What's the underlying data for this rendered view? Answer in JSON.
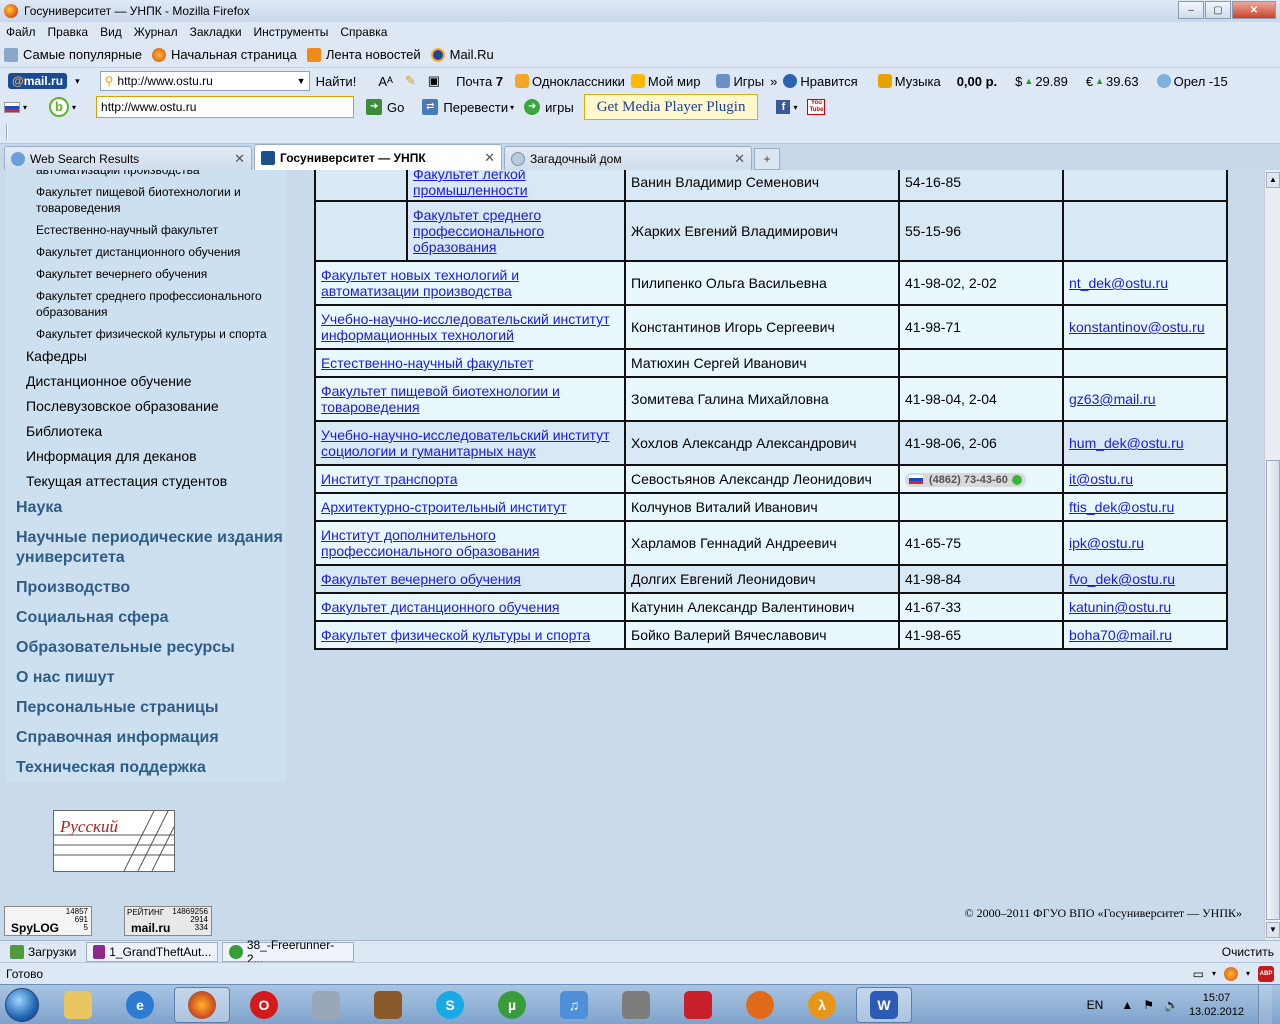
{
  "window": {
    "title": "Госуниверситет — УНПК - Mozilla Firefox",
    "min": "‒",
    "max": "▢",
    "close": "✕"
  },
  "menu": [
    "Файл",
    "Правка",
    "Вид",
    "Журнал",
    "Закладки",
    "Инструменты",
    "Справка"
  ],
  "bookmarks": [
    "Самые популярные",
    "Начальная страница",
    "Лента новостей",
    "Mail.Ru"
  ],
  "mailru_toolbar": {
    "logo_prefix": "@",
    "logo_text": "mail.ru",
    "url": "http://www.ostu.ru",
    "find": "Найти!",
    "mail": "Почта",
    "mail_count": "7",
    "odnoklassniki": "Одноклассники",
    "moimir": "Мой мир",
    "games": "Игры",
    "more": "»",
    "like": "Нравится",
    "music": "Музыка",
    "balance": "0,00 р.",
    "usd_sym": "$",
    "usd": "29.89",
    "eur_sym": "€",
    "eur": "39.63",
    "weather": "Орел -15"
  },
  "bing_toolbar": {
    "input": "http://www.ostu.ru",
    "go": "Go",
    "translate": "Перевести",
    "games": "игры",
    "media_plugin": "Get Media Player Plugin",
    "youtube": "You Tube"
  },
  "tabs": [
    {
      "label": "Web Search Results",
      "close": "✕"
    },
    {
      "label": "Госуниверситет — УНПК",
      "close": "✕"
    },
    {
      "label": "Загадочный дом",
      "close": "✕"
    }
  ],
  "newtab": "+",
  "left_nav": {
    "sub_items": [
      "автоматизации производства",
      "Факультет пищевой биотехнологии и товароведения",
      "Естественно-научный факультет",
      "Факультет дистанционного обучения",
      "Факультет вечернего обучения",
      "Факультет среднего профессионального образования",
      "Факультет физической культуры и спорта"
    ],
    "sections": [
      "Кафедры",
      "Дистанционное обучение",
      "Послевузовское образование",
      "Библиотека",
      "Информация для деканов",
      "Текущая аттестация студентов"
    ],
    "top_items": [
      "Наука",
      "Научные периодические издания университета",
      "Производство",
      "Социальная сфера",
      "Образовательные ресурсы",
      "О нас пишут",
      "Персональные страницы",
      "Справочная информация",
      "Техническая поддержка"
    ]
  },
  "table": {
    "sub_rows": [
      {
        "name": "Факультет легкой промышленности",
        "head": "Ванин Владимир Семенович",
        "phone": "54-16-85",
        "email": ""
      },
      {
        "name": "Факультет среднего профессионального образования",
        "head": "Жарких Евгений Владимирович",
        "phone": "55-15-96",
        "email": ""
      }
    ],
    "rows": [
      {
        "name": "Факультет новых технологий и автоматизации производства",
        "head": "Пилипенко Ольга Васильевна",
        "phone": "41-98-02, 2-02",
        "email": "nt_dek@ostu.ru"
      },
      {
        "name": "Учебно-научно-исследовательский институт информационных технологий",
        "head": "Константинов Игорь Сергеевич",
        "phone": "41-98-71",
        "email": "konstantinov@ostu.ru"
      },
      {
        "name": "Естественно-научный факультет",
        "head": "Матюхин Сергей Иванович",
        "phone": "",
        "email": ""
      },
      {
        "name": "Факультет пищевой биотехнологии и товароведения",
        "head": "Зомитева Галина Михайловна",
        "phone": "41-98-04, 2-04",
        "email": "gz63@mail.ru"
      },
      {
        "name": "Учебно-научно-исследовательский институт социологии и гуманитарных наук",
        "head": "Хохлов Александр Александрович",
        "phone": "41-98-06, 2-06",
        "email": "hum_dek@ostu.ru"
      },
      {
        "name": "Институт транспорта",
        "head": "Севостьянов Александр Леонидович",
        "phone": "(4862) 73-43-60",
        "email": "it@ostu.ru"
      },
      {
        "name": "Архитектурно-строительный институт",
        "head": "Колчунов Виталий Иванович",
        "phone": "",
        "email": "ftis_dek@ostu.ru"
      },
      {
        "name": "Институт дополнительного профессионального образования",
        "head": "Харламов Геннадий Андреевич",
        "phone": "41-65-75",
        "email": "ipk@ostu.ru"
      },
      {
        "name": "Факультет вечернего обучения",
        "head": "Долгих Евгений Леонидович",
        "phone": "41-98-84",
        "email": "fvo_dek@ostu.ru"
      },
      {
        "name": "Факультет дистанционного обучения",
        "head": "Катунин Александр Валентинович",
        "phone": "41-67-33",
        "email": "katunin@ostu.ru"
      },
      {
        "name": "Факультет физической культуры и спорта",
        "head": "Бойко Валерий Вячеславович",
        "phone": "41-98-65",
        "email": "boha70@mail.ru"
      }
    ]
  },
  "logo_russian": "Русский",
  "counter1": {
    "label": "SpyLOG",
    "n1": "14857",
    "n2": "691",
    "n3": "5"
  },
  "counter2": {
    "label": "mail.ru",
    "rating": "РЕЙТИНГ",
    "n1": "14869256",
    "n2": "2914",
    "n3": "334"
  },
  "copyright": "© 2000–2011 ФГУО ВПО «Госуниверситет — УНПК»",
  "downloads": {
    "label": "Загрузки",
    "items": [
      "1_GrandTheftAut...",
      "38_-Freerunner-2..."
    ],
    "clear": "Очистить"
  },
  "status": {
    "text": "Готово",
    "abp": "ABP"
  },
  "tray": {
    "lang": "EN",
    "time": "15:07",
    "date": "13.02.2012"
  }
}
